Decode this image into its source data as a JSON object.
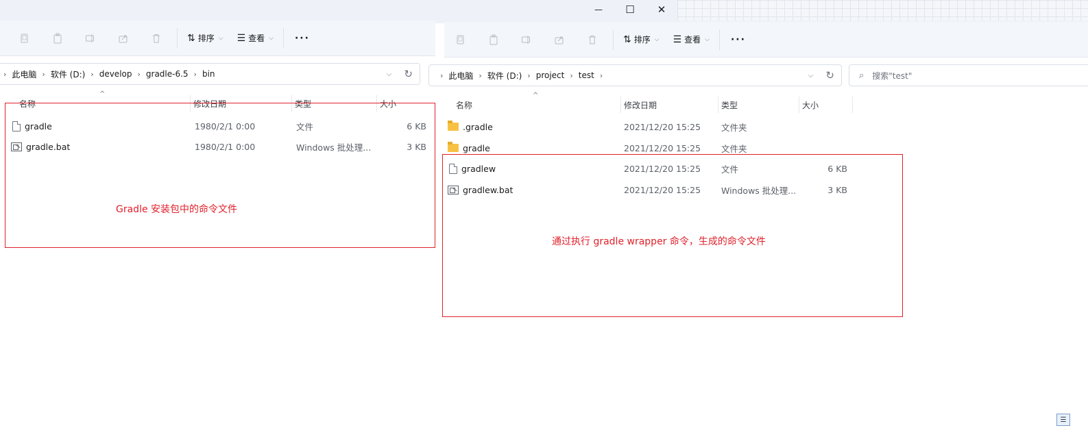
{
  "window_controls": {
    "minimize": "—",
    "maximize": "☐",
    "close": "✕"
  },
  "toolbar": {
    "sort_label": "排序",
    "view_label": "查看",
    "more_label": "···",
    "icons": [
      "copy-icon",
      "paste-icon",
      "rename-icon",
      "share-icon",
      "delete-icon",
      "sort-icon",
      "view-icon"
    ]
  },
  "left": {
    "breadcrumb": [
      "此电脑",
      "软件 (D:)",
      "develop",
      "gradle-6.5",
      "bin"
    ],
    "columns": {
      "name": "名称",
      "modified": "修改日期",
      "type": "类型",
      "size": "大小"
    },
    "rows": [
      {
        "name": "gradle",
        "modified": "1980/2/1 0:00",
        "type": "文件",
        "size": "6 KB",
        "icon": "file-icon"
      },
      {
        "name": "gradle.bat",
        "modified": "1980/2/1 0:00",
        "type": "Windows 批处理...",
        "size": "3 KB",
        "icon": "batch-file-icon"
      }
    ],
    "annotation": "Gradle 安装包中的命令文件"
  },
  "right": {
    "breadcrumb": [
      "此电脑",
      "软件 (D:)",
      "project",
      "test"
    ],
    "search_placeholder": "搜索\"test\"",
    "columns": {
      "name": "名称",
      "modified": "修改日期",
      "type": "类型",
      "size": "大小"
    },
    "rows": [
      {
        "name": ".gradle",
        "modified": "2021/12/20 15:25",
        "type": "文件夹",
        "size": "",
        "icon": "folder-icon"
      },
      {
        "name": "gradle",
        "modified": "2021/12/20 15:25",
        "type": "文件夹",
        "size": "",
        "icon": "folder-icon"
      },
      {
        "name": "gradlew",
        "modified": "2021/12/20 15:25",
        "type": "文件",
        "size": "6 KB",
        "icon": "file-icon"
      },
      {
        "name": "gradlew.bat",
        "modified": "2021/12/20 15:25",
        "type": "Windows 批处理...",
        "size": "3 KB",
        "icon": "batch-file-icon"
      }
    ],
    "annotation": "通过执行 gradle wrapper 命令，生成的命令文件"
  },
  "colors": {
    "annotation": "#e0202a",
    "folder": "#f7c244",
    "toolbar_bg": "#f3f6fb"
  }
}
